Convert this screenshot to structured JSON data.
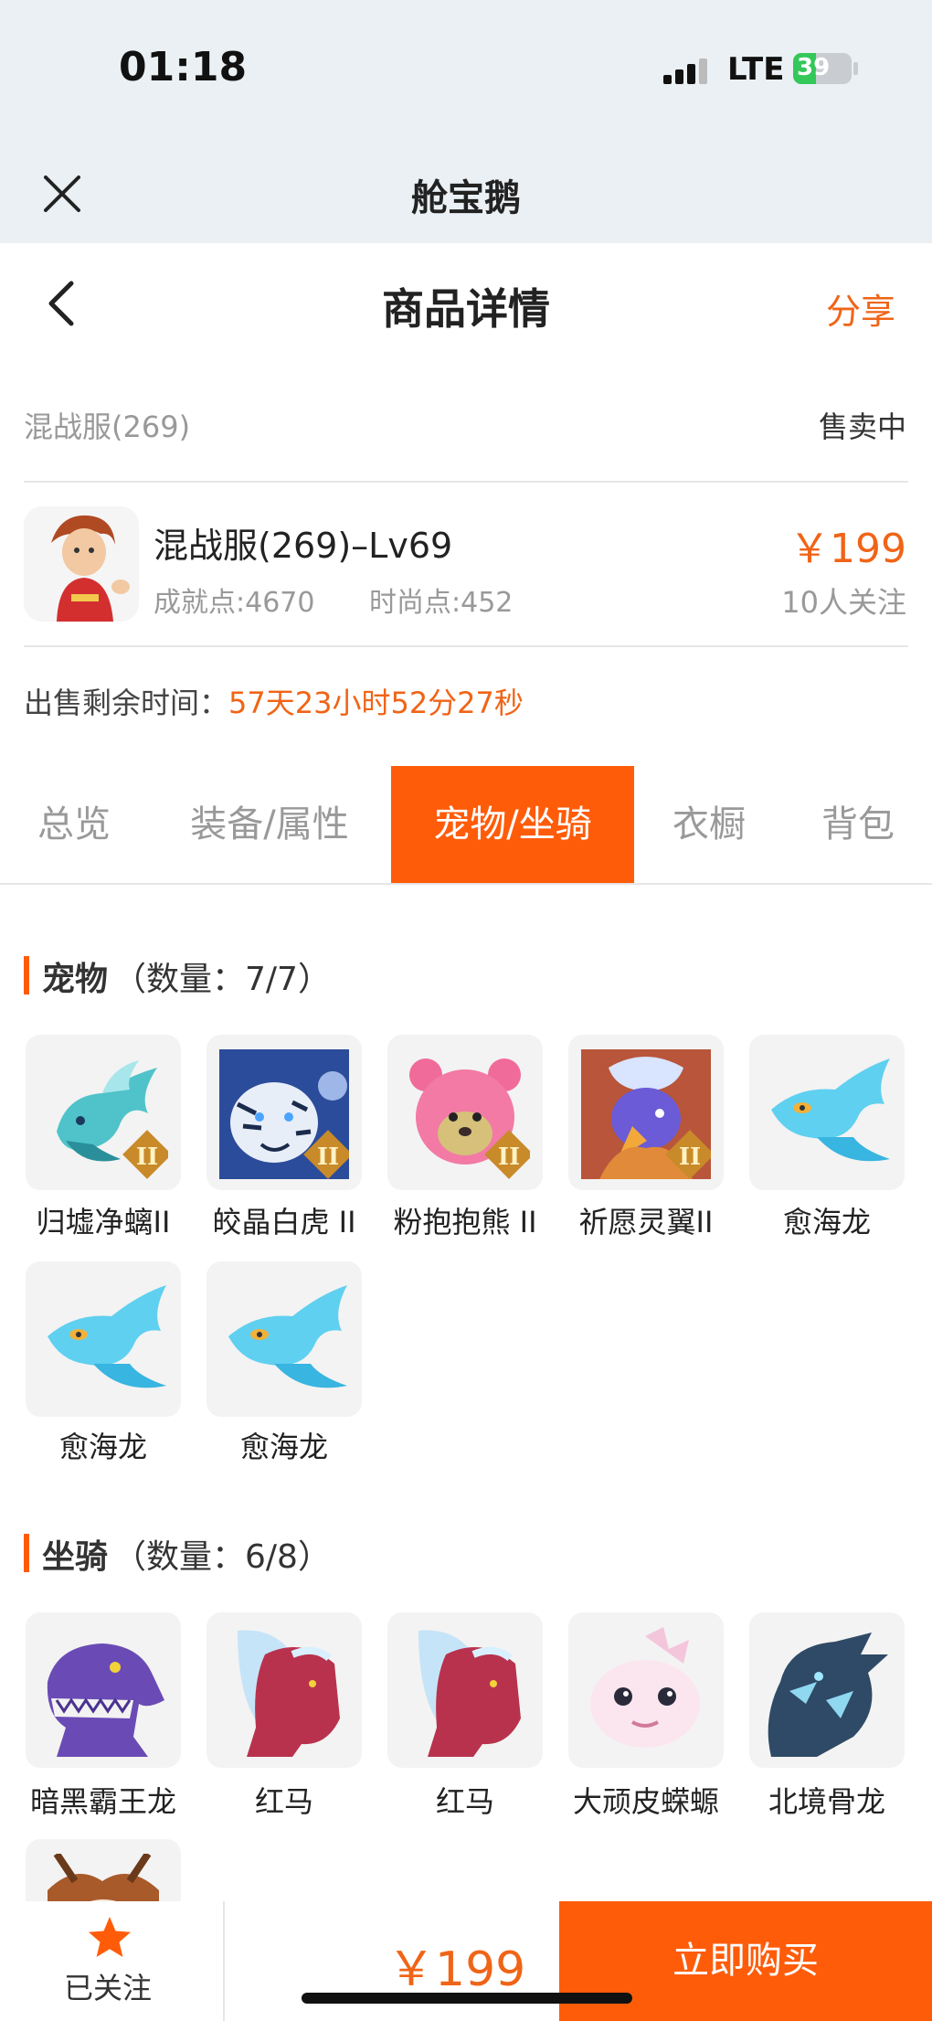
{
  "status_bar": {
    "time": "01:18",
    "network": "LTE",
    "battery": "39",
    "battery_level": 0.39
  },
  "app": {
    "title": "舱宝鹅",
    "close_icon": "close-icon"
  },
  "nav": {
    "title": "商品详情",
    "share_label": "分享",
    "back_icon": "back-chevron-icon"
  },
  "listing": {
    "server": "混战服(269)",
    "status": "售卖中",
    "name": "混战服(269)–Lv69",
    "achievement": "成就点:4670",
    "fashion": "时尚点:452",
    "price": "￥199",
    "followers": "10人关注",
    "remaining_label": "出售剩余时间：",
    "remaining_value": "57天23小时52分27秒"
  },
  "tabs": [
    {
      "label": "总览",
      "active": false
    },
    {
      "label": "装备/属性",
      "active": false
    },
    {
      "label": "宠物/坐骑",
      "active": true
    },
    {
      "label": "衣橱",
      "active": false
    },
    {
      "label": "背包",
      "active": false
    }
  ],
  "pets": {
    "title": "宠物",
    "count": "（数量：7/7）",
    "items": [
      {
        "name": "归墟净螭II",
        "badge": "II"
      },
      {
        "name": "皎晶白虎 II",
        "badge": "II"
      },
      {
        "name": "粉抱抱熊 II",
        "badge": "II"
      },
      {
        "name": "祈愿灵翼II",
        "badge": "II"
      },
      {
        "name": "愈海龙"
      },
      {
        "name": "愈海龙"
      },
      {
        "name": "愈海龙"
      }
    ]
  },
  "mounts": {
    "title": "坐骑",
    "count": "（数量：6/8）",
    "items": [
      {
        "name": "暗黑霸王龙"
      },
      {
        "name": "红马"
      },
      {
        "name": "红马"
      },
      {
        "name": "大顽皮蝾螈"
      },
      {
        "name": "北境骨龙"
      },
      {
        "name": ""
      }
    ]
  },
  "bottom": {
    "follow_label": "已关注",
    "price": "￥199",
    "buy_label": "立即购买",
    "star_icon": "star-icon"
  },
  "colors": {
    "accent": "#ff5c0a",
    "price": "#f06417",
    "header_bg": "#eaf0f4"
  }
}
